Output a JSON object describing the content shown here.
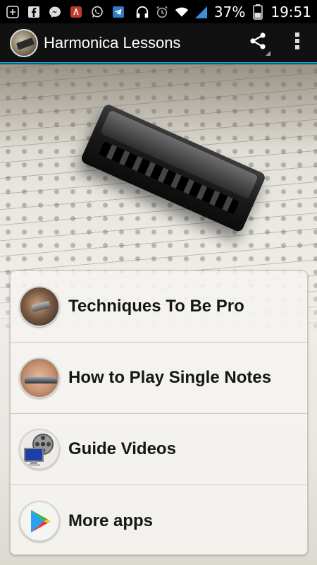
{
  "status_bar": {
    "battery_percent": "37%",
    "time": "19:51",
    "left_icons": [
      "add-box-icon",
      "facebook-icon",
      "messenger-icon",
      "app-notification-icon",
      "whatsapp-icon",
      "telegram-icon"
    ],
    "right_icons": [
      "headphones-icon",
      "alarm-icon",
      "wifi-icon",
      "signal-icon",
      "battery-icon"
    ]
  },
  "action_bar": {
    "title": "Harmonica Lessons",
    "actions": [
      "share-icon",
      "overflow-menu-icon"
    ],
    "accent_color": "#1aa3d9"
  },
  "menu": {
    "items": [
      {
        "label": "Techniques To Be Pro",
        "icon": "harmonica-player-thumb"
      },
      {
        "label": "How to Play Single Notes",
        "icon": "harmonica-hands-thumb"
      },
      {
        "label": "Guide Videos",
        "icon": "film-reel-computer-thumb"
      },
      {
        "label": "More apps",
        "icon": "play-store-icon"
      }
    ]
  }
}
